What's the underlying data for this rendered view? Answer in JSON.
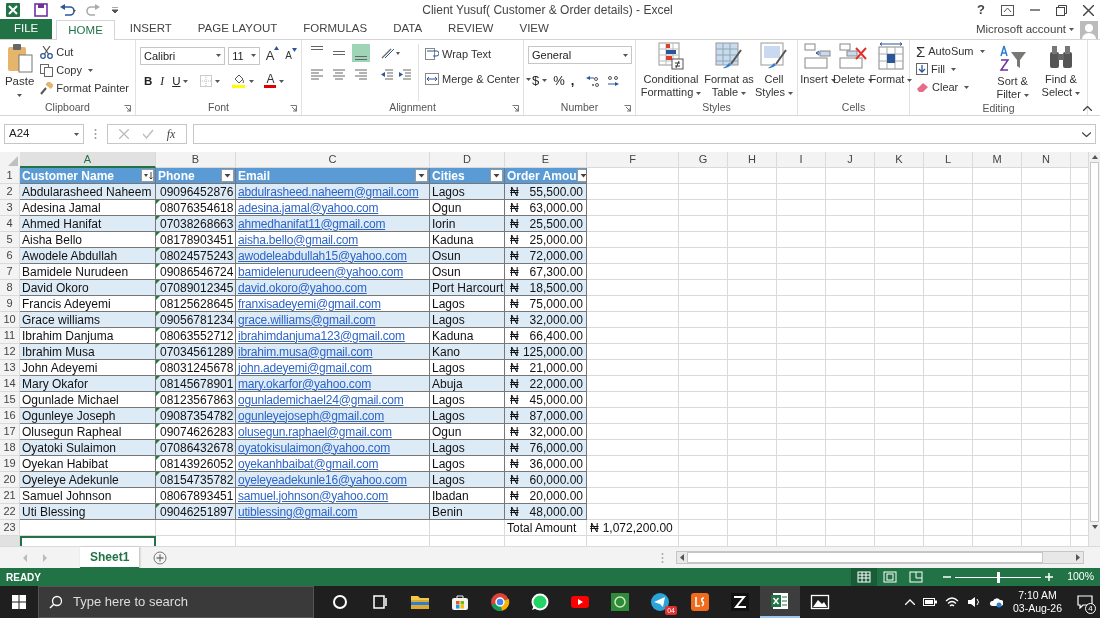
{
  "window": {
    "title": "Client Yusuf( Customer & Order details) - Excel",
    "help": "?"
  },
  "ribbon_tabs": [
    {
      "label": "FILE",
      "kind": "file",
      "selected": false
    },
    {
      "label": "HOME",
      "kind": "tab",
      "selected": true
    },
    {
      "label": "INSERT",
      "kind": "tab",
      "selected": false
    },
    {
      "label": "PAGE LAYOUT",
      "kind": "tab",
      "selected": false
    },
    {
      "label": "FORMULAS",
      "kind": "tab",
      "selected": false
    },
    {
      "label": "DATA",
      "kind": "tab",
      "selected": false
    },
    {
      "label": "REVIEW",
      "kind": "tab",
      "selected": false
    },
    {
      "label": "VIEW",
      "kind": "tab",
      "selected": false
    }
  ],
  "account": "Microsoft account",
  "clipboard": {
    "label": "Clipboard",
    "paste": "Paste",
    "cut": "Cut",
    "copy": "Copy",
    "format_painter": "Format Painter"
  },
  "font": {
    "label": "Font",
    "font_name": "Calibri",
    "font_size": "11",
    "grow": "A",
    "shrink": "A",
    "bold": "B",
    "italic": "I",
    "underline": "U",
    "font_color": "A"
  },
  "alignment": {
    "label": "Alignment",
    "vertical": [
      {
        "selected": false
      },
      {
        "selected": false
      },
      {
        "selected": true
      }
    ],
    "wrap_text": "Wrap Text",
    "merge_center": "Merge & Center"
  },
  "number": {
    "label": "Number",
    "format": "General",
    "currency": "$",
    "percent": "%",
    "comma": ","
  },
  "styles": {
    "label": "Styles",
    "conditional_formatting": "Conditional Formatting",
    "format_as_table": "Format as Table",
    "cell_styles": "Cell Styles"
  },
  "cells": {
    "label": "Cells",
    "insert": "Insert",
    "delete": "Delete",
    "format": "Format"
  },
  "editing": {
    "label": "Editing",
    "sigma": "Σ",
    "autosum": "AutoSum",
    "fill": "Fill",
    "clear": "Clear",
    "sort_filter": "Sort & Filter",
    "find_select": "Find & Select"
  },
  "formula_bar": {
    "name_box": "A24",
    "function_label": "fx"
  },
  "sheet": {
    "columns": [
      {
        "label": "A",
        "selected": true
      },
      {
        "label": "B",
        "selected": false
      },
      {
        "label": "C",
        "selected": false
      },
      {
        "label": "D",
        "selected": false
      },
      {
        "label": "E",
        "selected": false
      },
      {
        "label": "F",
        "selected": false
      },
      {
        "label": "G",
        "selected": false
      },
      {
        "label": "H",
        "selected": false
      },
      {
        "label": "I",
        "selected": false
      },
      {
        "label": "J",
        "selected": false
      },
      {
        "label": "K",
        "selected": false
      },
      {
        "label": "L",
        "selected": false
      },
      {
        "label": "M",
        "selected": false
      },
      {
        "label": "N",
        "selected": false
      }
    ]
  },
  "table": {
    "header_row_number": "1",
    "headers": [
      {
        "text": "Customer Name",
        "kind": "sorted"
      },
      {
        "text": "Phone",
        "kind": "filter"
      },
      {
        "text": "Email",
        "kind": "filter"
      },
      {
        "text": "Cities",
        "kind": "filter"
      },
      {
        "text": "Order Amou",
        "kind": "filter"
      }
    ],
    "rows": [
      {
        "number": "2",
        "name": "Abdularasheed Naheem",
        "phone": "09096452876",
        "phone_flag": false,
        "email": "abdulrasheed.naheem@gmail.com",
        "city": "Lagos",
        "currency": "₦",
        "amount": "55,500.00"
      },
      {
        "number": "3",
        "name": "Adesina Jamal",
        "phone": "08076354618",
        "phone_flag": true,
        "email": "adesina.jamal@yahoo.com",
        "city": "Ogun",
        "currency": "₦",
        "amount": "63,000.00"
      },
      {
        "number": "4",
        "name": "Ahmed Hanifat",
        "phone": "07038268663",
        "phone_flag": true,
        "email": "ahmedhanifat11@gmail.com",
        "city": "Iorin",
        "currency": "₦",
        "amount": "25,500.00"
      },
      {
        "number": "5",
        "name": "Aisha Bello",
        "phone": "08178903451",
        "phone_flag": true,
        "email": "aisha.bello@gmail.com",
        "city": "Kaduna",
        "currency": "₦",
        "amount": "25,000.00"
      },
      {
        "number": "6",
        "name": "Awodele Abdullah",
        "phone": "08024575243",
        "phone_flag": true,
        "email": "awodeleabdullah15@yahoo.com",
        "city": "Osun",
        "currency": "₦",
        "amount": "72,000.00"
      },
      {
        "number": "7",
        "name": "Bamidele Nurudeen",
        "phone": "09086546724",
        "phone_flag": true,
        "email": "bamidelenurudeen@yahoo.com",
        "city": "Osun",
        "currency": "₦",
        "amount": "67,300.00"
      },
      {
        "number": "8",
        "name": "David Okoro",
        "phone": "07089012345",
        "phone_flag": true,
        "email": "david.okoro@yahoo.com",
        "city": "Port Harcourt",
        "currency": "₦",
        "amount": "18,500.00"
      },
      {
        "number": "9",
        "name": "Francis Adeyemi",
        "phone": "08125628645",
        "phone_flag": true,
        "email": "franxisadeyemi@gmail.com",
        "city": "Lagos",
        "currency": "₦",
        "amount": "75,000.00"
      },
      {
        "number": "10",
        "name": "Grace williams",
        "phone": "09056781234",
        "phone_flag": true,
        "email": "grace.williams@gmail.com",
        "city": "Lagos",
        "currency": "₦",
        "amount": "32,000.00"
      },
      {
        "number": "11",
        "name": "Ibrahim Danjuma",
        "phone": "08063552712",
        "phone_flag": true,
        "email": "ibrahimdanjuma123@gmail.com",
        "city": "Kaduna",
        "currency": "₦",
        "amount": "66,400.00"
      },
      {
        "number": "12",
        "name": "Ibrahim Musa",
        "phone": "07034561289",
        "phone_flag": true,
        "email": "ibrahim.musa@gmail.com",
        "city": "Kano",
        "currency": "₦",
        "amount": "125,000.00"
      },
      {
        "number": "13",
        "name": "John Adeyemi",
        "phone": "08031245678",
        "phone_flag": true,
        "email": "john.adeyemi@gmail.com",
        "city": "Lagos",
        "currency": "₦",
        "amount": "21,000.00"
      },
      {
        "number": "14",
        "name": "Mary Okafor",
        "phone": "08145678901",
        "phone_flag": true,
        "email": "mary.okarfor@yahoo.com",
        "city": "Abuja",
        "currency": "₦",
        "amount": "22,000.00"
      },
      {
        "number": "15",
        "name": "Ogunlade Michael",
        "phone": "08123567863",
        "phone_flag": true,
        "email": "ogunlademichael24@gmail.com",
        "city": "Lagos",
        "currency": "₦",
        "amount": "45,000.00"
      },
      {
        "number": "16",
        "name": "Ogunleye Joseph",
        "phone": "09087354782",
        "phone_flag": true,
        "email": "ogunleyejoseph@gmail.com",
        "city": "Lagos",
        "currency": "₦",
        "amount": "87,000.00"
      },
      {
        "number": "17",
        "name": "Olusegun Rapheal",
        "phone": "09074626283",
        "phone_flag": true,
        "email": "olusegun.raphael@gmail.com",
        "city": "Ogun",
        "currency": "₦",
        "amount": "32,000.00"
      },
      {
        "number": "18",
        "name": "Oyatoki Sulaimon",
        "phone": "07086432678",
        "phone_flag": true,
        "email": "oyatokisulaimon@yahoo.com",
        "city": "Lagos",
        "currency": "₦",
        "amount": "76,000.00"
      },
      {
        "number": "19",
        "name": "Oyekan Habibat",
        "phone": "08143926052",
        "phone_flag": true,
        "email": "oyekanhbaibat@gmail.com",
        "city": "Lagos",
        "currency": "₦",
        "amount": "36,000.00"
      },
      {
        "number": "20",
        "name": "Oyeleye Adekunle",
        "phone": "08154735782",
        "phone_flag": true,
        "email": "oyeleyeadekunle16@yahoo.com",
        "city": "Lagos",
        "currency": "₦",
        "amount": "60,000.00"
      },
      {
        "number": "21",
        "name": "Samuel Johnson",
        "phone": "08067893451",
        "phone_flag": false,
        "email": "samuel.johnson@yahoo.com",
        "city": "Ibadan",
        "currency": "₦",
        "amount": "20,000.00"
      },
      {
        "number": "22",
        "name": "Uti Blessing",
        "phone": "09046251897",
        "phone_flag": true,
        "email": "utiblessing@gmail.com",
        "city": "Benin",
        "currency": "₦",
        "amount": "48,000.00"
      }
    ],
    "total": {
      "number": "23",
      "label": "Total Amount",
      "currency": "₦",
      "value": "1,072,200.00"
    }
  },
  "sheet_tabs": [
    {
      "label": "Sheet1",
      "selected": true
    }
  ],
  "status_bar": {
    "status": "READY",
    "views": [
      {
        "kind": "normal",
        "selected": true
      },
      {
        "kind": "page_layout",
        "selected": false
      },
      {
        "kind": "page_break",
        "selected": false
      }
    ],
    "zoom": {
      "level": 0.5
    },
    "zoom_label": "100%"
  },
  "taskbar": {
    "search": {
      "placeholder": "Type here to search"
    },
    "apps": [
      {
        "kind": "cortana",
        "active": false
      },
      {
        "kind": "task_view",
        "active": false
      },
      {
        "kind": "explorer",
        "active": false
      },
      {
        "kind": "store",
        "active": false
      },
      {
        "kind": "chrome",
        "active": false
      },
      {
        "kind": "whatsapp",
        "active": false
      },
      {
        "kind": "youtube",
        "active": false
      },
      {
        "kind": "green_app",
        "active": false
      },
      {
        "kind": "telegram",
        "active": false,
        "badge": "04"
      },
      {
        "kind": "ls",
        "active": false
      },
      {
        "kind": "pen",
        "active": false
      },
      {
        "kind": "excel",
        "active": true
      },
      {
        "kind": "photos",
        "active": false
      }
    ],
    "time": "7:10 AM",
    "date": "03-Aug-26",
    "notifications": "4"
  }
}
